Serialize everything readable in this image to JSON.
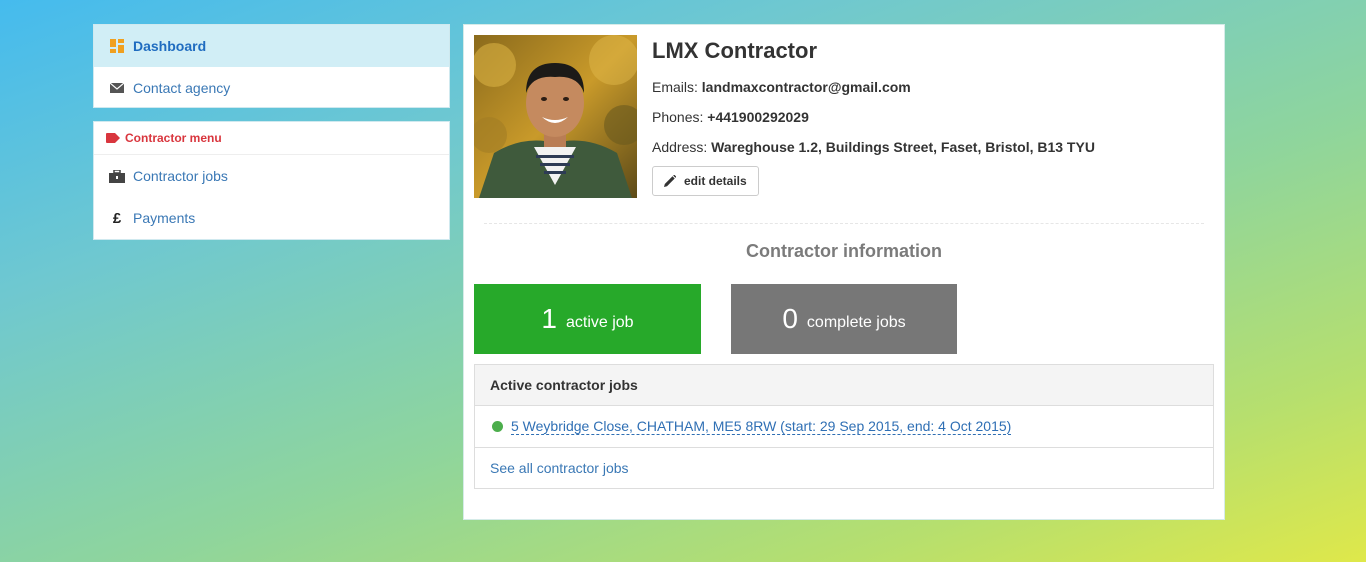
{
  "sidebar": {
    "dashboard_label": "Dashboard",
    "contact_agency_label": "Contact agency",
    "contractor_menu": {
      "header": "Contractor menu",
      "items": [
        {
          "label": "Contractor jobs",
          "icon": "briefcase-icon"
        },
        {
          "label": "Payments",
          "icon": "pound-icon"
        }
      ]
    }
  },
  "profile": {
    "name": "LMX Contractor",
    "emails_label": "Emails:",
    "emails_value": "landmaxcontractor@gmail.com",
    "phones_label": "Phones:",
    "phones_value": "+441900292029",
    "address_label": "Address:",
    "address_value": "Wareghouse 1.2, Buildings Street, Faset, Bristol, B13 TYU",
    "edit_button": "edit details"
  },
  "contractor_info": {
    "title": "Contractor information",
    "active": {
      "count": "1",
      "label": "active job",
      "color": "#27a92a"
    },
    "complete": {
      "count": "0",
      "label": "complete jobs",
      "color": "#777777"
    }
  },
  "active_jobs": {
    "header": "Active contractor jobs",
    "jobs": [
      {
        "text": "5 Weybridge Close, CHATHAM, ME5 8RW (start: 29 Sep 2015, end: 4 Oct 2015)",
        "status_color": "#4cae4c"
      }
    ],
    "see_all": "See all contractor jobs"
  },
  "colors": {
    "accent_link": "#3a78b5",
    "active_nav_bg": "#d1eef6",
    "menu_header": "#d9363e"
  }
}
